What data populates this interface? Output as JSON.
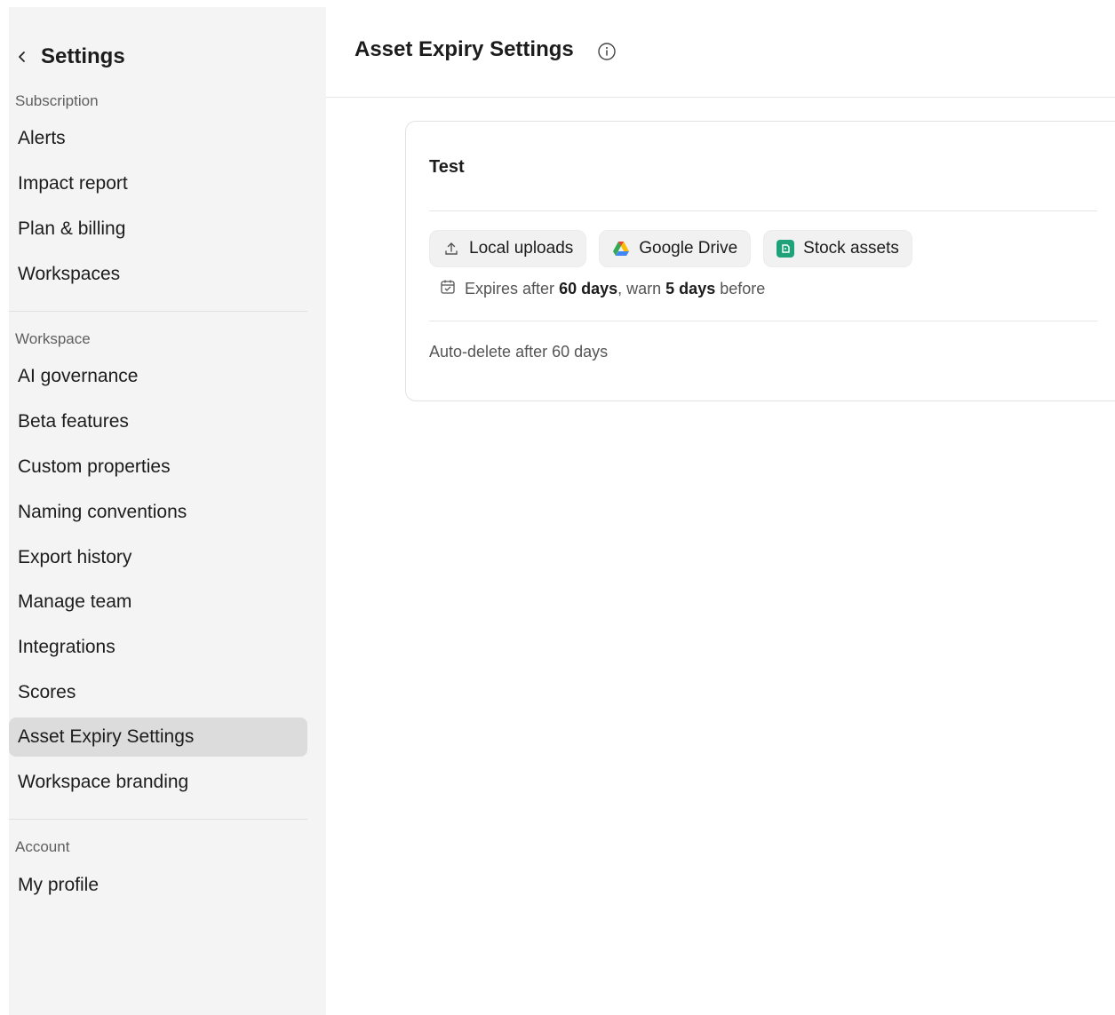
{
  "sidebar": {
    "title": "Settings",
    "sections": {
      "subscription": {
        "label": "Subscription",
        "items": [
          "Alerts",
          "Impact report",
          "Plan & billing",
          "Workspaces"
        ]
      },
      "workspace": {
        "label": "Workspace",
        "items": [
          "AI governance",
          "Beta features",
          "Custom properties",
          "Naming conventions",
          "Export history",
          "Manage team",
          "Integrations",
          "Scores",
          "Asset Expiry Settings",
          "Workspace branding"
        ]
      },
      "account": {
        "label": "Account",
        "items": [
          "My profile"
        ]
      }
    },
    "active_item": "Asset Expiry Settings"
  },
  "header": {
    "title": "Asset Expiry Settings",
    "info_icon": "info-icon"
  },
  "card": {
    "title": "Test",
    "chips": [
      {
        "label": "Local uploads",
        "icon": "upload-icon"
      },
      {
        "label": "Google Drive",
        "icon": "google-drive-icon"
      },
      {
        "label": "Stock assets",
        "icon": "stock-assets-icon"
      }
    ],
    "expiry": {
      "prefix": "Expires after",
      "days": "60 days",
      "mid": ", warn",
      "warn_days": "5 days",
      "suffix": "before"
    },
    "auto_delete": "Auto-delete after 60 days"
  },
  "colors": {
    "sidebar_bg": "#f4f4f4",
    "active_item_bg": "#dcdcdc",
    "stock_icon": "#1fa27a"
  }
}
